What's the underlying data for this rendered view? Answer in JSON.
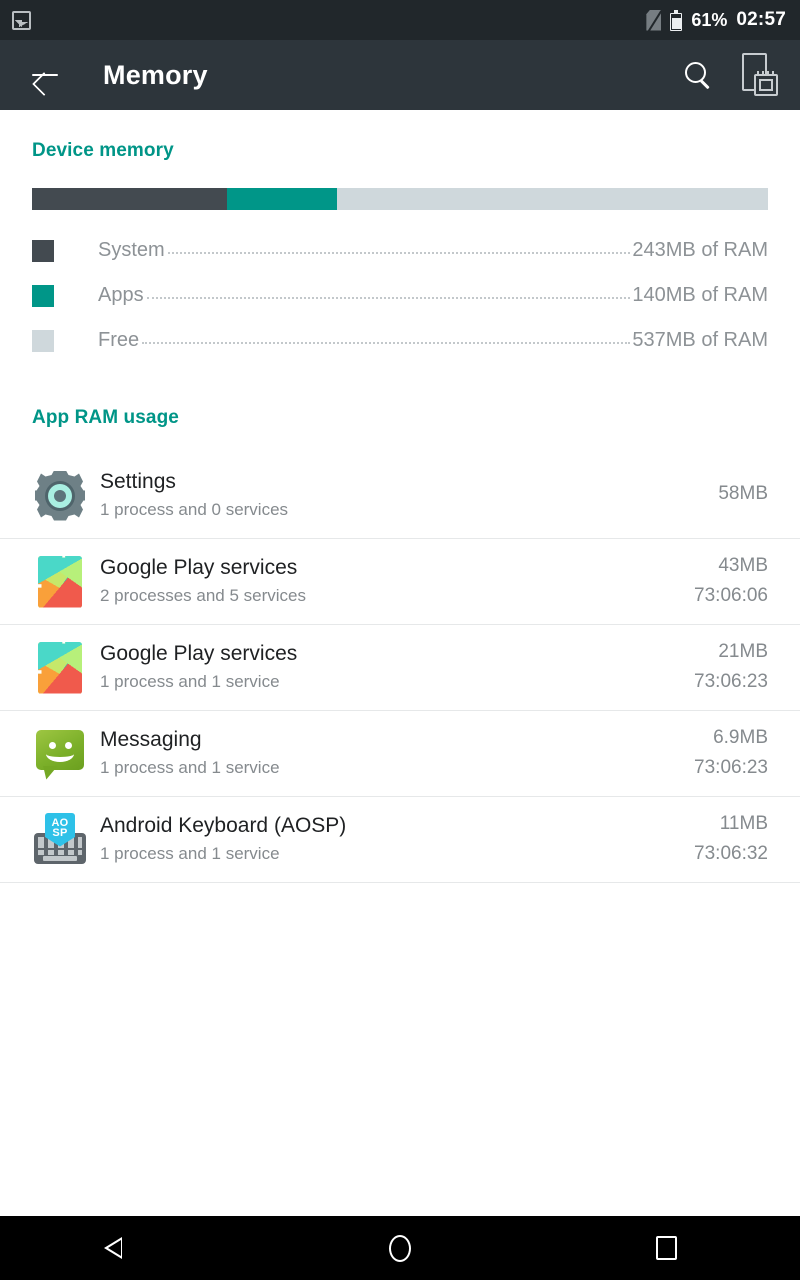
{
  "status_bar": {
    "notification_icon": "screenshot-icon",
    "sim_icon": "no-sim-icon",
    "battery_icon": "battery-icon",
    "battery_percent": "61%",
    "clock": "02:57"
  },
  "action_bar": {
    "back_icon": "back-arrow-icon",
    "title": "Memory",
    "search_icon": "search-icon",
    "memory_icon": "memory-chip-icon"
  },
  "device_memory": {
    "heading": "Device memory",
    "legend": [
      {
        "label": "System",
        "value": "243MB of RAM",
        "color": "#434a50",
        "percent": 26.5
      },
      {
        "label": "Apps",
        "value": "140MB of RAM",
        "color": "#009688",
        "percent": 15.0
      },
      {
        "label": "Free",
        "value": "537MB of RAM",
        "color": "#cfd8dc",
        "percent": 58.5
      }
    ]
  },
  "app_ram_usage": {
    "heading": "App RAM usage",
    "rows": [
      {
        "icon": "settings-gear-icon",
        "name": "Settings",
        "subtitle": "1 process and 0 services",
        "size": "58MB",
        "time": ""
      },
      {
        "icon": "google-play-icon",
        "name": "Google Play services",
        "subtitle": "2 processes and 5 services",
        "size": "43MB",
        "time": "73:06:06"
      },
      {
        "icon": "google-play-icon",
        "name": "Google Play services",
        "subtitle": "1 process and 1 service",
        "size": "21MB",
        "time": "73:06:23"
      },
      {
        "icon": "messaging-icon",
        "name": "Messaging",
        "subtitle": "1 process and 1 service",
        "size": "6.9MB",
        "time": "73:06:23"
      },
      {
        "icon": "aosp-keyboard-icon",
        "name": "Android Keyboard (AOSP)",
        "subtitle": "1 process and 1 service",
        "size": "11MB",
        "time": "73:06:32"
      }
    ]
  },
  "nav_bar": {
    "back_icon": "nav-back-icon",
    "home_icon": "nav-home-icon",
    "recents_icon": "nav-recents-icon"
  },
  "theme": {
    "accent": "#009587",
    "action_bar_bg": "#2d353b",
    "status_bar_bg": "#21272b"
  },
  "keyboard_tag": {
    "line1": "AO",
    "line2": "SP"
  }
}
